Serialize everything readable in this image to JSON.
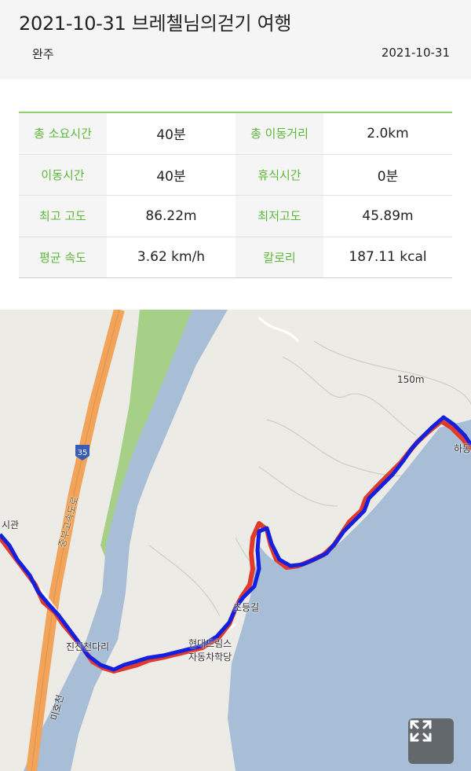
{
  "header": {
    "title": "2021-10-31 브레첼님의걷기 여행",
    "region": "완주",
    "date": "2021-10-31"
  },
  "stats": [
    {
      "label": "총 소요시간",
      "value": "40분",
      "label2": "총 이동거리",
      "value2": "2.0km"
    },
    {
      "label": "이동시간",
      "value": "40분",
      "label2": "휴식시간",
      "value2": "0분"
    },
    {
      "label": "최고 고도",
      "value": "86.22m",
      "label2": "최저고도",
      "value2": "45.89m"
    },
    {
      "label": "평균 속도",
      "value": "3.62 km/h",
      "label2": "칼로리",
      "value2": "187.11 kcal"
    }
  ],
  "map": {
    "labels": {
      "elev": "150m",
      "sigwan": "시관",
      "bridge": "진천천다리",
      "school": "현대드림스\n자동차학당",
      "chor": "초등길",
      "hal": "하동",
      "river": "미호천",
      "highway": "중부고속도로",
      "route": "35"
    },
    "colors": {
      "track_planned": "#e23a2a",
      "track_actual": "#1420e0",
      "water": "#a8bdd6",
      "forest": "#a6cf88",
      "highway": "#f1a45a"
    }
  },
  "controls": {
    "fullscreen_icon": "expand-arrows-icon"
  }
}
